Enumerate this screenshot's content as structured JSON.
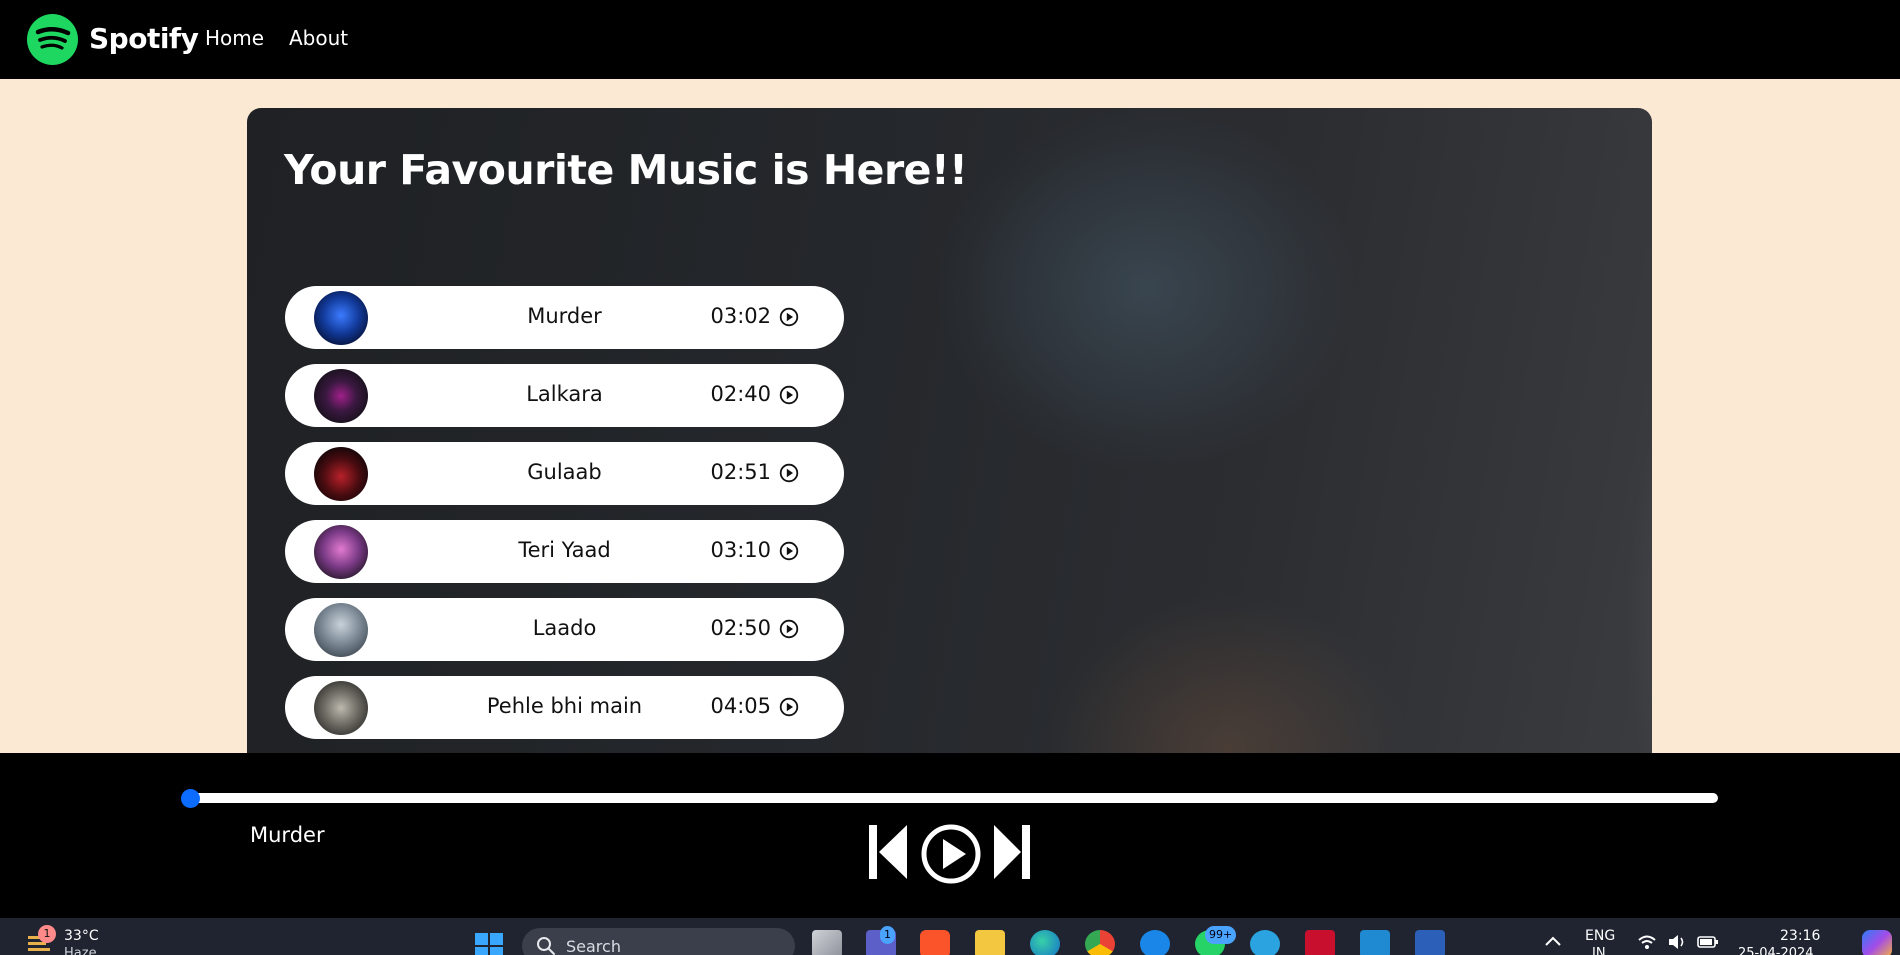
{
  "nav": {
    "brand": "Spotify",
    "links": [
      "Home",
      "About"
    ]
  },
  "main": {
    "title": "Your Favourite Music is Here!!",
    "songs": [
      {
        "name": "Murder",
        "duration": "03:02"
      },
      {
        "name": "Lalkara",
        "duration": "02:40"
      },
      {
        "name": "Gulaab",
        "duration": "02:51"
      },
      {
        "name": "Teri Yaad",
        "duration": "03:10"
      },
      {
        "name": "Laado",
        "duration": "02:50"
      },
      {
        "name": "Pehle bhi main",
        "duration": "04:05"
      }
    ]
  },
  "player": {
    "now_playing": "Murder",
    "progress_percent": 0
  },
  "taskbar": {
    "weather_badge": "1",
    "temperature": "33°C",
    "weather_text": "Haze",
    "search_placeholder": "Search",
    "teams_badge": "1",
    "whatsapp_badge": "99+",
    "language": "ENG",
    "region": "IN",
    "time": "23:16",
    "date": "25-04-2024"
  },
  "colors": {
    "brand_green": "#1ed760",
    "page_bg": "#fbe9d4",
    "progress_thumb": "#0b6cff"
  }
}
